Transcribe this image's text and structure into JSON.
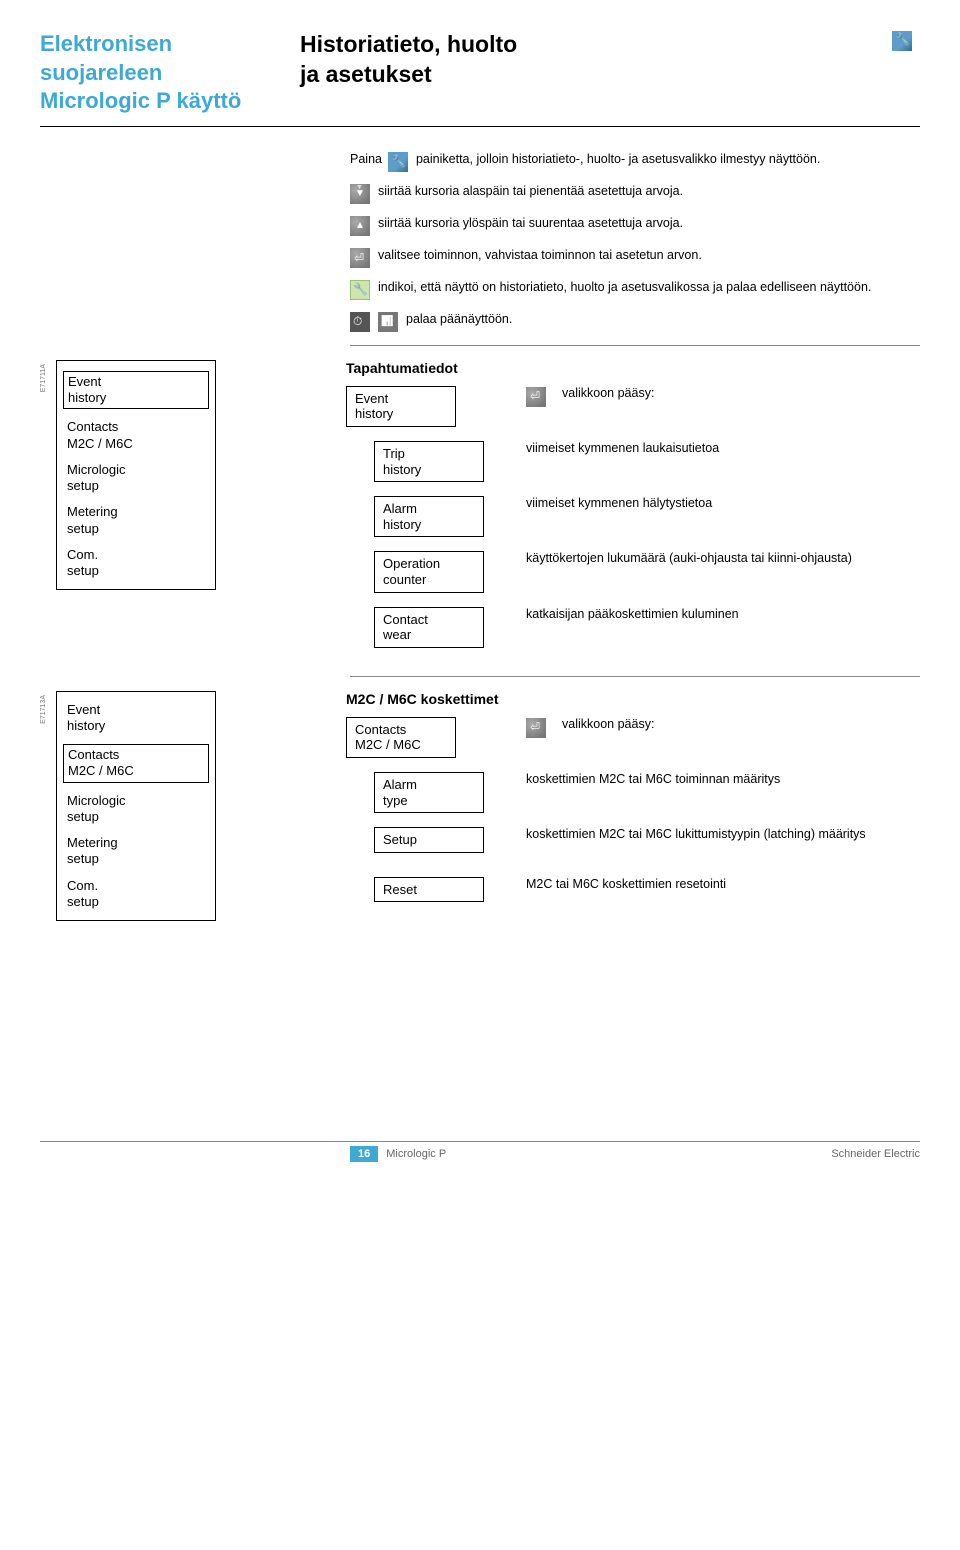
{
  "header": {
    "left_line1": "Elektronisen",
    "left_line2": "suojareleen",
    "left_line3": "Micrologic P käyttö",
    "right_line1": "Historiatieto, huolto",
    "right_line2": "ja asetukset"
  },
  "intro": {
    "press": "Paina",
    "press_after": "painiketta, jolloin historiatieto-, huolto- ja asetusvalikko ilmestyy näyttöön.",
    "down": "siirtää kursoria alaspäin tai pienentää asetettuja arvoja.",
    "up": "siirtää kursoria ylöspäin tai suurentaa asetettuja arvoja.",
    "enter": "valitsee toiminnon, vahvistaa toiminnon tai asetetun arvon.",
    "ghost": "indikoi, että näyttö on historiatieto, huolto ja asetusvalikossa ja palaa edelliseen näyttöön.",
    "back": "palaa päänäyttöön."
  },
  "section1": {
    "code": "E71711A",
    "menu": {
      "i1": "Event\nhistory",
      "i2": "Contacts\nM2C / M6C",
      "i3": "Micrologic\nsetup",
      "i4": "Metering\nsetup",
      "i5": "Com.\nsetup"
    },
    "title": "Tapahtumatiedot",
    "rows": {
      "r1": {
        "chip": "Event\nhistory",
        "desc": "valikkoon pääsy:"
      },
      "r2": {
        "chip": "Trip\nhistory",
        "desc": "viimeiset kymmenen laukaisutietoa"
      },
      "r3": {
        "chip": "Alarm\nhistory",
        "desc": "viimeiset kymmenen hälytystietoa"
      },
      "r4": {
        "chip": "Operation\ncounter",
        "desc": "käyttökertojen lukumäärä (auki-ohjausta tai kiinni-ohjausta)"
      },
      "r5": {
        "chip": "Contact\nwear",
        "desc": "katkaisijan pääkoskettimien kuluminen"
      }
    }
  },
  "section2": {
    "code": "E71713A",
    "menu": {
      "i1": "Event\nhistory",
      "i2": "Contacts\nM2C / M6C",
      "i3": "Micrologic\nsetup",
      "i4": "Metering\nsetup",
      "i5": "Com.\nsetup"
    },
    "title": "M2C / M6C koskettimet",
    "rows": {
      "r1": {
        "chip": "Contacts\nM2C / M6C",
        "desc": "valikkoon pääsy:"
      },
      "r2": {
        "chip": "Alarm\ntype",
        "desc": "koskettimien M2C tai M6C toiminnan määritys"
      },
      "r3": {
        "chip": "Setup",
        "desc": "koskettimien M2C tai M6C lukittumistyypin (latching) määritys"
      },
      "r4": {
        "chip": "Reset",
        "desc": "M2C tai M6C koskettimien resetointi"
      }
    }
  },
  "footer": {
    "page": "16",
    "mid": "Micrologic P",
    "right": "Schneider Electric"
  }
}
